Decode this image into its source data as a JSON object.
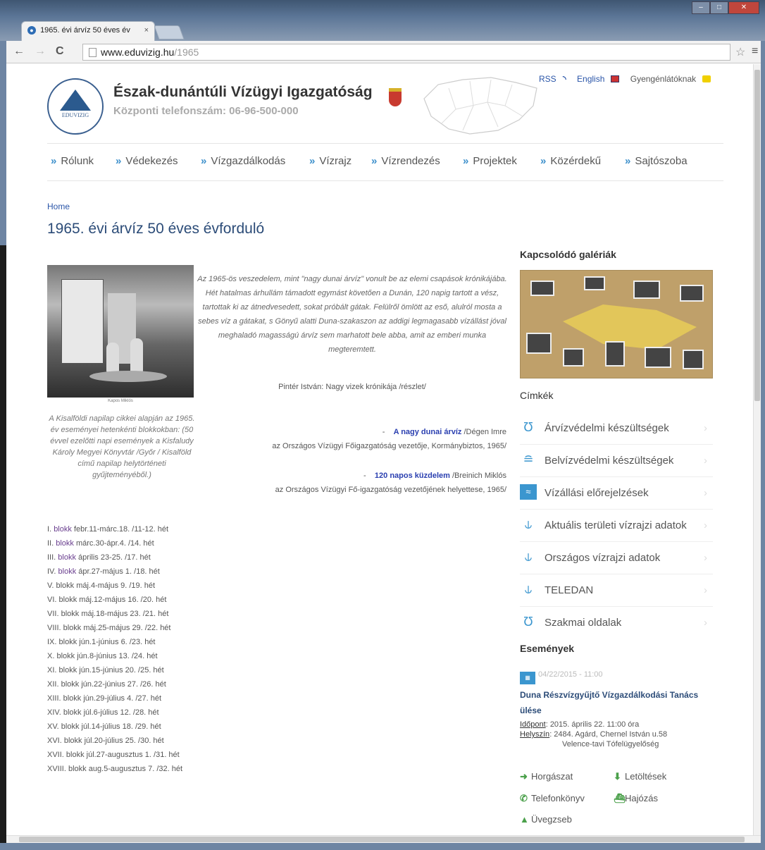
{
  "browser": {
    "tab_title": "1965. évi árvíz 50 éves év",
    "tab_close": "×",
    "url_host": "www.eduvizig.hu",
    "url_path": "/1965",
    "back": "←",
    "forward": "→",
    "reload": "C",
    "star": "☆",
    "menu": "≡"
  },
  "header": {
    "logo_text": "EDUVIZIG",
    "org_name": "Észak-dunántúli Vízügyi Igazgatóság",
    "phone": "Központi telefonszám: 06-96-500-000",
    "links": {
      "rss": "RSS",
      "english": "English",
      "accessible": "Gyengénlátóknak"
    }
  },
  "nav": {
    "marker": "»",
    "items": [
      "Rólunk",
      "Védekezés",
      "Vízgazdálkodás",
      "Vízrajz",
      "Vízrendezés",
      "Projektek",
      "Közérdekű",
      "Sajtószoba"
    ]
  },
  "breadcrumb": "Home",
  "page_title": "1965. évi árvíz 50 éves évforduló",
  "photo_caption": "Kapos Miklós",
  "left_note": "A Kisalföldi napilap cikkei alapján az 1965. év eseményei hetenkénti blokkokban: (50 évvel ezelőtti napi események a Kisfaludy Károly Megyei Könyvtár /Győr / Kisalföld című napilap helytörténeti gyűjteményéből.)",
  "blocks": [
    {
      "num": "I.",
      "link": "blokk",
      "text": "febr.11-márc.18. /11-12. hét"
    },
    {
      "num": "II.",
      "link": "blokk",
      "text": "márc.30-ápr.4. /14. hét"
    },
    {
      "num": "III.",
      "link": "blokk",
      "text": "április 23-25. /17. hét"
    },
    {
      "num": "IV.",
      "link": "blokk",
      "text": "ápr.27-május 1. /18. hét"
    },
    {
      "num": "V.",
      "link": "",
      "text": "blokk máj.4-május 9. /19. hét"
    },
    {
      "num": "VI.",
      "link": "",
      "text": "blokk máj.12-május 16. /20. hét"
    },
    {
      "num": "VII.",
      "link": "",
      "text": "blokk máj.18-május 23. /21. hét"
    },
    {
      "num": "VIII.",
      "link": "",
      "text": "blokk máj.25-május 29. /22. hét"
    },
    {
      "num": "IX.",
      "link": "",
      "text": "blokk jún.1-június 6. /23. hét"
    },
    {
      "num": "X.",
      "link": "",
      "text": "blokk jún.8-június 13. /24. hét"
    },
    {
      "num": "XI.",
      "link": "",
      "text": "blokk jún.15-június 20. /25. hét"
    },
    {
      "num": "XII.",
      "link": "",
      "text": "blokk jún.22-június 27. /26. hét"
    },
    {
      "num": "XIII.",
      "link": "",
      "text": "blokk jún.29-július 4. /27. hét"
    },
    {
      "num": "XIV.",
      "link": "",
      "text": "blokk júl.6-július 12. /28. hét"
    },
    {
      "num": "XV.",
      "link": "",
      "text": "blokk júl.14-július 18. /29. hét"
    },
    {
      "num": "XVI.",
      "link": "",
      "text": "blokk júl.20-július 25. /30. hét"
    },
    {
      "num": "XVII.",
      "link": "",
      "text": "blokk júl.27-augusztus 1. /31. hét"
    },
    {
      "num": "XVIII.",
      "link": "",
      "text": "blokk aug.5-augusztus 7. /32. hét"
    }
  ],
  "quote": "Az 1965-ös veszedelem, mint \"nagy dunai árvíz\" vonult be az elemi csapások krónikájába. Hét hatalmas árhullám támadott egymást követően a Dunán, 120 napig tartott a vész, tartottak ki az átnedvesedett, sokat próbált gátak. Felülről ömlött az eső, alulról mosta a sebes víz a gátakat, s Gönyű alatti Duna-szakaszon az addigi legmagasabb vízállást jóval meghaladó magasságú árvíz sem marhatott bele abba, amit az emberi munka megteremtett.",
  "quote_author": "Pintér István: Nagy vizek krónikája /részlet/",
  "refs": [
    {
      "dash": "-",
      "link": "A nagy dunai árvíz",
      "tail": "/Dégen Imre",
      "line2": "az Országos Vízügyi Főigazgatóság vezetője, Kormánybiztos, 1965/"
    },
    {
      "dash": "-",
      "link": "120 napos küzdelem",
      "tail": "/Breinich Miklós",
      "line2": "az Országos Vízügyi Fő-igazgatóság vezetőjének helyettese, 1965/"
    }
  ],
  "sidebar": {
    "galleries_title": "Kapcsolódó galériák",
    "tags_title": "Címkék",
    "tags": [
      {
        "icon": "flood-icon",
        "label": "Árvízvédelmi készültségek"
      },
      {
        "icon": "inland-water-icon",
        "label": "Belvízvédelmi készültségek"
      },
      {
        "icon": "chart-icon",
        "label": "Vízállási előrejelzések"
      },
      {
        "icon": "gauge-icon",
        "label": "Aktuális területi vízrajzi adatok"
      },
      {
        "icon": "gauge-icon",
        "label": "Országos vízrajzi adatok"
      },
      {
        "icon": "gauge-icon",
        "label": "TELEDAN"
      },
      {
        "icon": "flood-icon",
        "label": "Szakmai oldalak"
      }
    ],
    "tag_chevron": "›",
    "events_title": "Események",
    "event": {
      "date": "04/22/2015 - 11:00",
      "title": "Duna Részvízgyűjtő Vízgazdálkodási Tanács ülése",
      "time_label": "Időpont",
      "time_value": ": 2015. április 22. 11:00 óra",
      "place_label": "Helyszín",
      "place_value": ": 2484. Agárd, Chernel István u.58",
      "place_line2": "Velence-tavi Tófelügyelőség"
    },
    "quicklinks": [
      "Horgászat",
      "Letöltések",
      "Telefonkönyv",
      "Hajózás",
      "Üvegzseb"
    ]
  }
}
